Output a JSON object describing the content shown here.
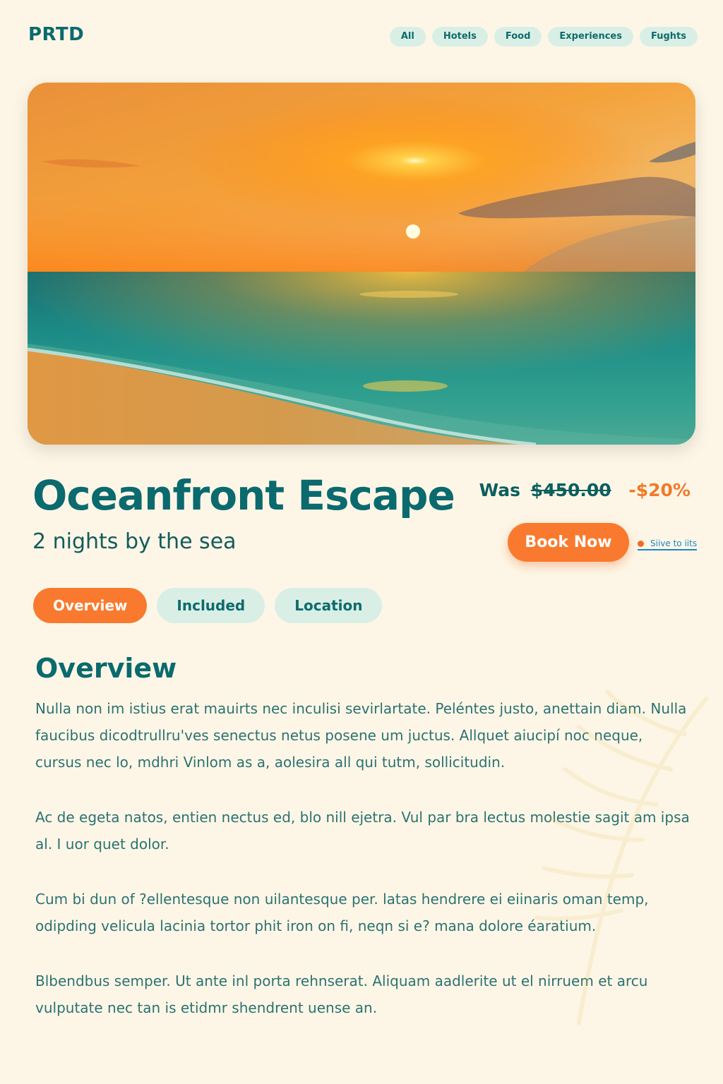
{
  "brand": "PRTD",
  "nav": [
    "All",
    "Hotels",
    "Food",
    "Experiences",
    "Fughts"
  ],
  "hero_image": {
    "alt": "Sunset over the ocean at the beach"
  },
  "listing": {
    "title": "Oceanfront Escape",
    "subtitle": "2 nights by the sea",
    "price_prefix": "Was",
    "was_price": "$450.00",
    "discount": "-$20%",
    "book_label": "Book Now",
    "save_label": "Siive to iits"
  },
  "tabs": [
    "Overview",
    "Included",
    "Location"
  ],
  "active_tab": "Overview",
  "section": {
    "heading": "Overview",
    "paragraphs": [
      "Nulla non im istius erat mauirts nec inculisi sevirlartate. Peléntes justo, anettain diam. Nulla faucibus dicodtrullru'ves senectus netus posene um juctus. Allquet aiucipí noc neque, cursus nec lo, mdhri Vinlom as a, aolesira all qui tutm, sollicitudin.",
      "Ac de egeta natos, entien nectus ed, blo nill ejetra. Vul par bra lectus molestie sagit am ipsa al. I uor quet dolor.",
      "Cum bi dun of ?ellentesque non uilantesque per. latas hendrere ei eiinaris oman temp, odipding velicula lacinia tortor phit iron on fi, neqn si e? mana dolore éaratium.",
      "Blbendbus semper. Ut ante inl porta rehnserat. Aliquam aadlerite ut el nirruem et arcu vulputate nec tan is etidmr shendrent uense an."
    ]
  },
  "colors": {
    "background": "#fdf6e6",
    "primary_teal": "#0a6a6e",
    "accent_orange": "#f97a2e",
    "pill_mint": "#d9efe6",
    "link_blue": "#1b86c5"
  }
}
